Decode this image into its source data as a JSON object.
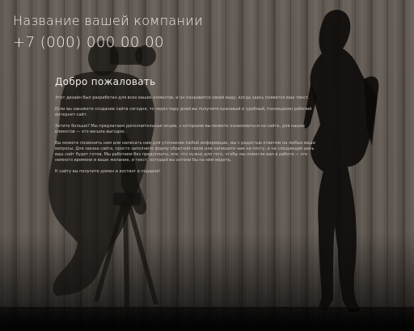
{
  "header": {
    "company_name": "Название вашей компании",
    "phone": "+7 (000) 000 00 00"
  },
  "main": {
    "heading": "Добро пожаловать",
    "paragraphs": [
      "Этот дизайн был разработан для всех ваших клиентов, и он понравится своей виду, когда здесь появится ваш текст.",
      "Если вы закажете создание сайта сегодня, то через пару дней вы получите красивый и удобный, полноценно рабочий интернет-сайт.",
      "Хотите больше? Мы предлагаем дополнительные опции, с которыми вы можете ознакомиться на сайте, для наших клиентов — это весьма выгодно.",
      "Вы можете позвонить нам или написать нам для уточнения любой информации, мы с радостью ответим на любые ваши вопросы. Для заказа сайта, просто заполните форму обратной связи или напишите нам на почту, и на следующий день ваш сайт будет готов. Мы работаем без предоплаты, все, что нужно для того, чтобы мы помогли вам в работе — это немного времени и ваше желание, и текст, который вы хотели бы на нём видеть.",
      "К сайту вы получите домен и хостинг в подарок!"
    ]
  },
  "colors": {
    "text_primary": "#f1ece6",
    "text_body": "#cfc7bf",
    "wood": "#5e5650"
  },
  "icons": {
    "photographer": "photographer-silhouette",
    "model": "model-silhouette"
  }
}
